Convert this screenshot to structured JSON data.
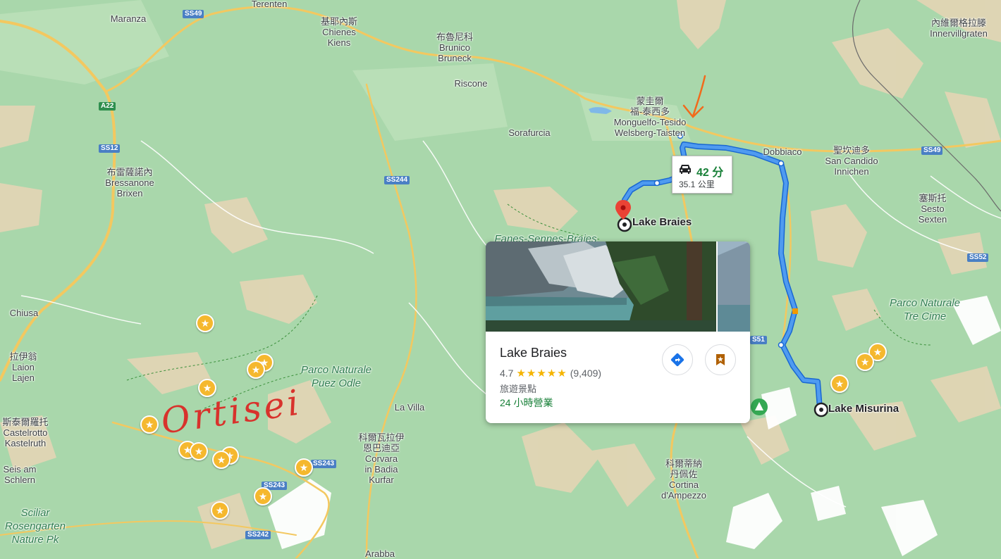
{
  "map": {
    "places": [
      {
        "id": "maranza",
        "text": "Maranza"
      },
      {
        "id": "terenten",
        "text": "Terenten"
      },
      {
        "id": "chienes",
        "text": "基耶內斯\nChienes\nKiens"
      },
      {
        "id": "brunico",
        "text": "布魯尼科\nBrunico\nBruneck"
      },
      {
        "id": "riscone",
        "text": "Riscone"
      },
      {
        "id": "monguelfo",
        "text": "蒙圭爾\n福-泰西多\nMonguelfo-Tesido\nWelsberg-Taisten"
      },
      {
        "id": "sorafurcia",
        "text": "Sorafurcia"
      },
      {
        "id": "dobbiaco",
        "text": "Dobbiaco"
      },
      {
        "id": "sancandido",
        "text": "聖坎迪多\nSan Candido\nInnichen"
      },
      {
        "id": "innervillgraten",
        "text": "內維爾格拉滕\nInnervillgraten"
      },
      {
        "id": "brixen",
        "text": "布雷薩諾內\nBressanone\nBrixen"
      },
      {
        "id": "sesto",
        "text": "塞斯托\nSesto\nSexten"
      },
      {
        "id": "chiusa",
        "text": "Chiusa"
      },
      {
        "id": "laion",
        "text": "拉伊翁\nLaion\nLajen"
      },
      {
        "id": "castelrotto",
        "text": "斯泰爾羅托\nCastelrotto\nKastelruth"
      },
      {
        "id": "seis",
        "text": "Seis am\nSchlern"
      },
      {
        "id": "lavilla",
        "text": "La Villa"
      },
      {
        "id": "corvara",
        "text": "科爾瓦拉伊\n恩巴迪亞\nCorvara\nin Badia\nKurfar"
      },
      {
        "id": "cortina",
        "text": "科爾蒂納\n丹佩佐\nCortina\nd'Ampezzo"
      },
      {
        "id": "arabba",
        "text": "Arabba"
      }
    ],
    "parks": [
      {
        "id": "puez",
        "text": "Parco Naturale\nPuez Odle"
      },
      {
        "id": "trecime",
        "text": "Parco Naturale\nTre Cime"
      },
      {
        "id": "sciliar",
        "text": "Sciliar\nRosengarten\nNature Pk"
      },
      {
        "id": "fanes",
        "text": "Fanes-Sennes-Braies"
      }
    ],
    "roads": [
      {
        "id": "ss49a",
        "text": "SS49",
        "color": "blue"
      },
      {
        "id": "a22",
        "text": "A22",
        "color": "green"
      },
      {
        "id": "ss12",
        "text": "SS12",
        "color": "blue"
      },
      {
        "id": "ss244",
        "text": "SS244",
        "color": "blue"
      },
      {
        "id": "ss49b",
        "text": "SS49",
        "color": "blue"
      },
      {
        "id": "ss52",
        "text": "SS52",
        "color": "blue"
      },
      {
        "id": "ss51",
        "text": "S51",
        "color": "blue"
      },
      {
        "id": "ss243a",
        "text": "SS243",
        "color": "blue"
      },
      {
        "id": "ss243b",
        "text": "SS243",
        "color": "blue"
      },
      {
        "id": "ss242",
        "text": "SS242",
        "color": "blue"
      }
    ],
    "destinations": {
      "origin": "Lake Braies",
      "destination": "Lake Misurina"
    },
    "annotation": "Ortisei"
  },
  "route": {
    "duration": "42 分",
    "distance": "35.1 公里",
    "color": "#1a73e8"
  },
  "place_card": {
    "title": "Lake Braies",
    "rating": "4.7",
    "stars": "★★★★★",
    "reviews": "(9,409)",
    "category": "旅遊景點",
    "hours": "24 小時營業",
    "directions_icon": "directions-icon",
    "save_icon": "bookmark-icon"
  }
}
